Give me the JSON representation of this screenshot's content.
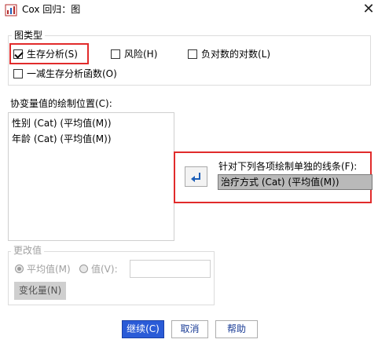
{
  "window": {
    "title": "Cox 回归：图"
  },
  "chart_type_group": {
    "label": "图类型",
    "options": [
      {
        "label": "生存分析(S)",
        "checked": true
      },
      {
        "label": "风险(H)",
        "checked": false
      },
      {
        "label": "负对数的对数(L)",
        "checked": false
      },
      {
        "label": "一减生存分析函数(O)",
        "checked": false
      }
    ]
  },
  "covariate": {
    "label": "协变量值的绘制位置(C):",
    "items": [
      "性别 (Cat) (平均值(M))",
      "年龄 (Cat) (平均值(M))"
    ]
  },
  "separate_lines": {
    "label": "针对下列各项绘制单独的线条(F):",
    "value": "治疗方式 (Cat) (平均值(M))",
    "move_icon": "arrow-return-left"
  },
  "change_value": {
    "label": "更改值",
    "mean_label": "平均值(M)",
    "value_label": "值(V):",
    "change_button": "变化量(N)"
  },
  "buttons": {
    "continue": "继续(C)",
    "cancel": "取消",
    "help": "帮助"
  },
  "colors": {
    "highlight": "#e12b2b",
    "primary": "#2a5bd7"
  }
}
